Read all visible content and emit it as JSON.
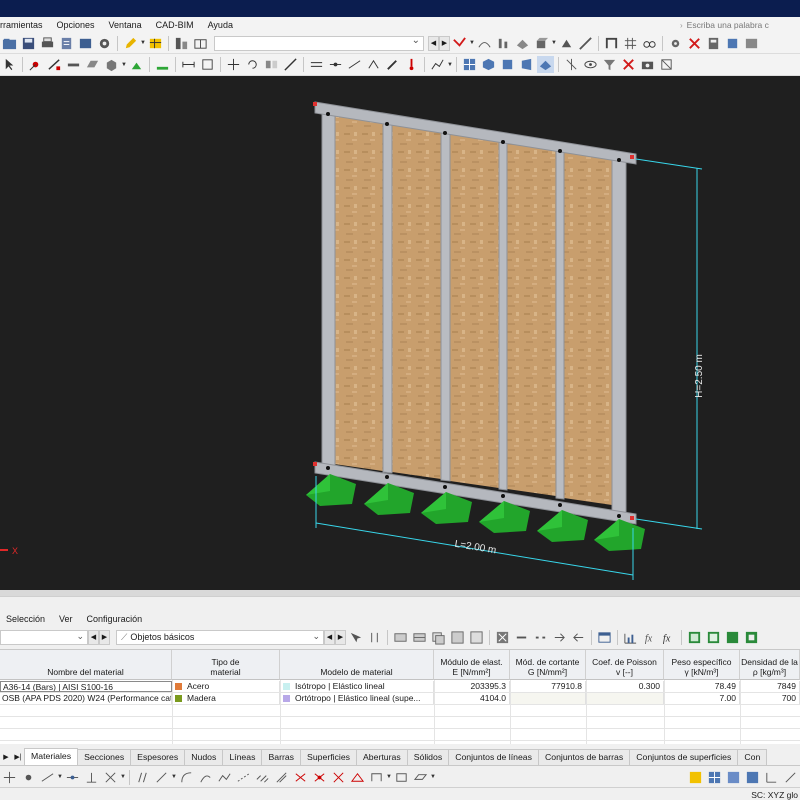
{
  "menu": {
    "items": [
      "rramientas",
      "Opciones",
      "Ventana",
      "CAD-BIM",
      "Ayuda"
    ],
    "search_placeholder": "Escriba una palabra c"
  },
  "viewport": {
    "dim_height": "H=2.50 m",
    "dim_length": "L=2.00 m",
    "axis_label": "X"
  },
  "panel": {
    "menu": [
      "Selección",
      "Ver",
      "Configuración"
    ],
    "filter_combo": "Objetos básicos"
  },
  "table": {
    "headers": [
      {
        "line1": "",
        "line2": "Nombre del material"
      },
      {
        "line1": "Tipo de",
        "line2": "material"
      },
      {
        "line1": "",
        "line2": "Modelo de material"
      },
      {
        "line1": "Módulo de elast.",
        "line2": "E [N/mm²]"
      },
      {
        "line1": "Mód. de cortante",
        "line2": "G [N/mm²]"
      },
      {
        "line1": "Coef. de Poisson",
        "line2": "v [--]"
      },
      {
        "line1": "Peso específico",
        "line2": "γ [kN/m³]"
      },
      {
        "line1": "Densidad de la",
        "line2": "ρ [kg/m³]"
      }
    ],
    "rows": [
      {
        "name": "A36-14 (Bars) | AISI S100-16",
        "type": "Acero",
        "type_color": "#e07b39",
        "model": "Isótropo | Elástico lineal",
        "model_color": "#c8f0f0",
        "E": "203395.3",
        "G": "77910.8",
        "nu": "0.300",
        "gamma": "78.49",
        "rho": "7849"
      },
      {
        "name": "OSB (APA PDS 2020) W24 (Performance cat...",
        "type": "Madera",
        "type_color": "#7a9a1e",
        "model": "Ortótropo | Elástico lineal (supe...",
        "model_color": "#b8a8e8",
        "E": "4104.0",
        "G": "",
        "nu": "",
        "gamma": "7.00",
        "rho": "700"
      }
    ]
  },
  "tabs": [
    "Materiales",
    "Secciones",
    "Espesores",
    "Nudos",
    "Líneas",
    "Barras",
    "Superficies",
    "Aberturas",
    "Sólidos",
    "Conjuntos de líneas",
    "Conjuntos de barras",
    "Conjuntos de superficies",
    "Con"
  ],
  "active_tab": "Materiales",
  "status": {
    "coord_system": "SC: XYZ glo"
  },
  "colors": {
    "title_bar": "#0b1d4f",
    "viewport_bg": "#1f1f1f",
    "support_green": "#22a52b",
    "dimension_cyan": "#38d6ea",
    "osb_panel": "#c9a071",
    "stud_gray": "#b9bcc2"
  }
}
